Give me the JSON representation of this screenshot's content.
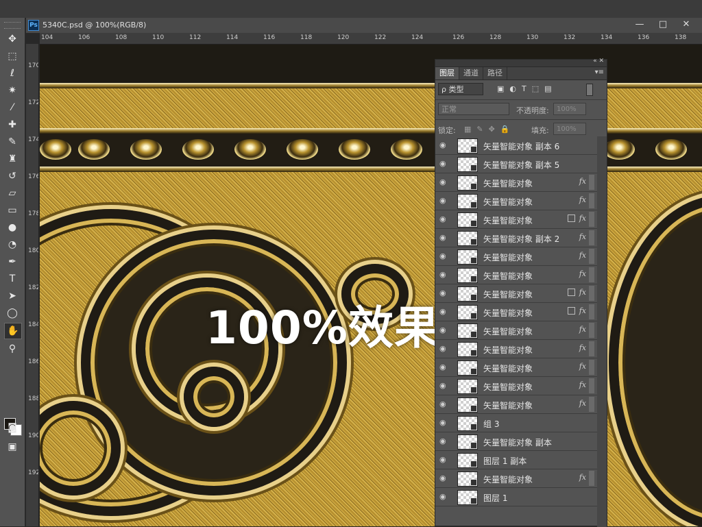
{
  "document": {
    "title": "5340C.psd @ 100%(RGB/8)",
    "app_icon": "Ps"
  },
  "window_controls": {
    "minimize": "—",
    "maximize": "□",
    "close": "✕"
  },
  "ruler": {
    "horizontal": [
      "104",
      "106",
      "108",
      "110",
      "112",
      "114",
      "116",
      "118",
      "120",
      "122",
      "124",
      "126",
      "128",
      "130",
      "132",
      "134",
      "136",
      "138"
    ],
    "vertical": [
      "170",
      "172",
      "174",
      "176",
      "178",
      "180",
      "182",
      "184",
      "186",
      "188",
      "190",
      "192"
    ]
  },
  "tools": [
    "move-icon",
    "marquee-icon",
    "lasso-icon",
    "magic-wand-icon",
    "eyedropper-icon",
    "healing-brush-icon",
    "brush-icon",
    "clone-stamp-icon",
    "history-brush-icon",
    "eraser-icon",
    "gradient-icon",
    "blur-icon",
    "dodge-icon",
    "pen-icon",
    "type-icon",
    "path-select-icon",
    "ellipse-icon",
    "hand-icon",
    "zoom-icon"
  ],
  "canvas": {
    "overlay_text": "100%效果展示"
  },
  "colors": {
    "foreground": "#1a1712",
    "background": "#ffffff",
    "gold": "#c9a43e"
  },
  "layers_panel": {
    "tabs": [
      "图层",
      "通道",
      "路径"
    ],
    "filter_label": "ρ 类型",
    "blend_mode": "正常",
    "opacity_label": "不透明度:",
    "opacity_value": "100%",
    "lock_label": "锁定:",
    "fill_label": "填充:",
    "fill_value": "100%",
    "layers": [
      {
        "name": "矢量智能对象 副本 6",
        "fx": "",
        "link": false
      },
      {
        "name": "矢量智能对象 副本 5",
        "fx": "",
        "link": false
      },
      {
        "name": "矢量智能对象",
        "fx": "fx",
        "link": false
      },
      {
        "name": "矢量智能对象",
        "fx": "fx",
        "link": false
      },
      {
        "name": "矢量智能对象",
        "fx": "fx",
        "link": true
      },
      {
        "name": "矢量智能对象 副本 2",
        "fx": "fx",
        "link": false
      },
      {
        "name": "矢量智能对象",
        "fx": "fx",
        "link": false
      },
      {
        "name": "矢量智能对象",
        "fx": "fx",
        "link": false
      },
      {
        "name": "矢量智能对象",
        "fx": "fx",
        "link": true
      },
      {
        "name": "矢量智能对象",
        "fx": "fx",
        "link": true
      },
      {
        "name": "矢量智能对象",
        "fx": "fx",
        "link": false
      },
      {
        "name": "矢量智能对象",
        "fx": "fx",
        "link": false
      },
      {
        "name": "矢量智能对象",
        "fx": "fx",
        "link": false
      },
      {
        "name": "矢量智能对象",
        "fx": "fx",
        "link": false
      },
      {
        "name": "矢量智能对象",
        "fx": "fx",
        "link": false
      },
      {
        "name": "组 3",
        "fx": "",
        "link": false
      },
      {
        "name": "矢量智能对象 副本",
        "fx": "",
        "link": false
      },
      {
        "name": "图层 1 副本",
        "fx": "",
        "link": false
      },
      {
        "name": "矢量智能对象",
        "fx": "fx",
        "link": false
      },
      {
        "name": "图层 1",
        "fx": "",
        "link": false
      }
    ]
  }
}
